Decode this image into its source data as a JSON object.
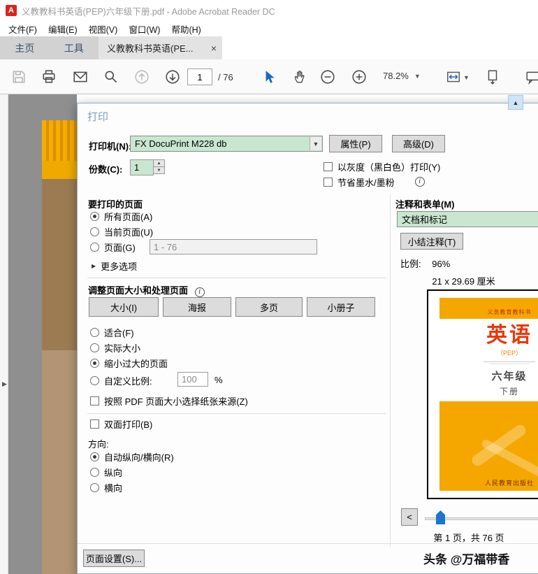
{
  "colors": {
    "field-green": "#c9e7d0",
    "accent-blue": "#1b75d1",
    "dialog-title": "#7aa0c6",
    "cover-yellow": "#f5a700",
    "cover-red": "#e8380d"
  },
  "title_bar": {
    "app_title": "义教教科书英语(PEP)六年级下册.pdf - Adobe Acrobat Reader DC"
  },
  "menu": {
    "items": [
      "文件(F)",
      "编辑(E)",
      "视图(V)",
      "窗口(W)",
      "帮助(H)"
    ]
  },
  "tabs": {
    "home": "主页",
    "tools": "工具",
    "document": "义教教科书英语(PE...",
    "close": "×"
  },
  "toolbar": {
    "page_value": "1",
    "page_total": "/ 76",
    "zoom_value": "78.2%"
  },
  "print_dialog": {
    "title": "打印",
    "printer": {
      "label": "打印机(N):",
      "value": "FX DocuPrint M228 db",
      "properties": "属性(P)",
      "advanced": "高级(D)"
    },
    "copies": {
      "label": "份数(C):",
      "value": "1"
    },
    "grayscale": "以灰度（黑白色）打印(Y)",
    "save_ink": "节省墨水/墨粉",
    "pages_to_print": {
      "heading": "要打印的页面",
      "all": "所有页面(A)",
      "current": "当前页面(U)",
      "pages": "页面(G)",
      "range_value": "1 - 76",
      "more_options": "更多选项"
    },
    "sizing": {
      "heading": "调整页面大小和处理页面",
      "size_btn": "大小(I)",
      "poster_btn": "海报",
      "multiple_btn": "多页",
      "booklet_btn": "小册子",
      "fit": "适合(F)",
      "actual": "实际大小",
      "shrink": "缩小过大的页面",
      "custom": "自定义比例:",
      "custom_value": "100",
      "percent": "%",
      "paper_source": "按照 PDF 页面大小选择纸张来源(Z)"
    },
    "duplex": "双面打印(B)",
    "orientation": {
      "heading": "方向:",
      "auto": "自动纵向/横向(R)",
      "portrait": "纵向",
      "landscape": "横向"
    },
    "comments": {
      "heading": "注释和表单(M)",
      "value": "文档和标记",
      "summarize": "小结注释(T)"
    },
    "scale_label": "比例:",
    "scale_value": "96%",
    "paper_size": "21 x 29.69 厘米",
    "page_nav": {
      "prev": "<",
      "status": "第 1 页，共 76 页"
    },
    "page_setup": "页面设置(S)..."
  },
  "preview_cover": {
    "series": "义务教育教科书",
    "title": "英语",
    "edition": "（PEP）",
    "grade": "六年级",
    "volume": "下册",
    "publisher": "人民教育出版社"
  },
  "watermark": "头条 @万福带香"
}
